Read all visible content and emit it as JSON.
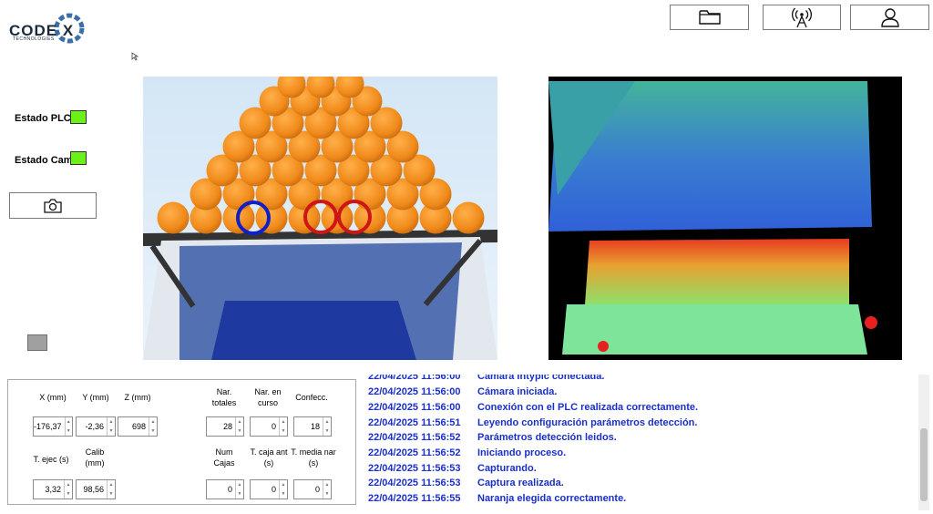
{
  "logo": {
    "name": "CODE X",
    "subtitle": "TECHNOLOGIES"
  },
  "toolbar": {
    "folder_icon": "folder-icon",
    "antenna_icon": "antenna-icon",
    "user_icon": "user-icon"
  },
  "status": {
    "plc_label": "Estado PLC",
    "cam_label": "Estado Cam",
    "led_color": "#6cf01a"
  },
  "capture_button_icon": "camera-icon",
  "fields": {
    "x_label": "X (mm)",
    "x_value": "-176,37",
    "y_label": "Y (mm)",
    "y_value": "-2,36",
    "z_label": "Z (mm)",
    "z_value": "698",
    "texec_label": "T. ejec (s)",
    "texec_value": "3,32",
    "calib_label": "Calib (mm)",
    "calib_value": "98,56",
    "nar_tot_label": "Nar. totales",
    "nar_tot_value": "28",
    "nar_curso_label": "Nar. en curso",
    "nar_curso_value": "0",
    "confecc_label": "Confecc.",
    "confecc_value": "18",
    "num_cajas_label": "Num Cajas",
    "num_cajas_value": "0",
    "tcaja_label": "T. caja ant (s)",
    "tcaja_value": "0",
    "tmedia_label": "T. media nar (s)",
    "tmedia_value": "0"
  },
  "log": [
    {
      "ts": "22/04/2025 11:56:00",
      "msg": "Cámara Intypic conectada."
    },
    {
      "ts": "22/04/2025 11:56:00",
      "msg": "Cámara iniciada."
    },
    {
      "ts": "22/04/2025 11:56:00",
      "msg": "Conexión con el PLC realizada correctamente."
    },
    {
      "ts": "22/04/2025 11:56:51",
      "msg": "Leyendo configuración parámetros detección."
    },
    {
      "ts": "22/04/2025 11:56:52",
      "msg": "Parámetros detección leidos."
    },
    {
      "ts": "22/04/2025 11:56:52",
      "msg": "Iniciando proceso."
    },
    {
      "ts": "22/04/2025 11:56:53",
      "msg": "Capturando."
    },
    {
      "ts": "22/04/2025 11:56:53",
      "msg": "Captura realizada."
    },
    {
      "ts": "22/04/2025 11:56:55",
      "msg": "Naranja elegida correctamente."
    }
  ]
}
